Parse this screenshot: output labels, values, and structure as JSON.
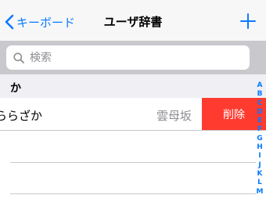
{
  "colors": {
    "accent": "#0a7aff",
    "delete": "#ff3b30",
    "secondary_text": "#8e8e93"
  },
  "navbar": {
    "back_icon": "chevron-left-icon",
    "back_label": "キーボード",
    "title": "ユーザ辞書",
    "add_icon": "plus-icon"
  },
  "search": {
    "icon": "search-icon",
    "placeholder": "検索",
    "value": ""
  },
  "section": {
    "title": "か"
  },
  "entries": [
    {
      "reading": "ららざか",
      "word": "雲母坂",
      "delete_label": "削除"
    }
  ],
  "index_letters": [
    "A",
    "B",
    "C",
    "D",
    "E",
    "F",
    "G",
    "H",
    "I",
    "J",
    "K",
    "L",
    "M"
  ]
}
